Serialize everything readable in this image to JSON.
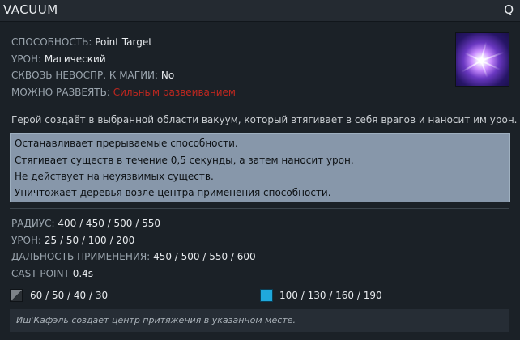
{
  "header": {
    "title": "VACUUM",
    "hotkey": "Q"
  },
  "ability_icon": {
    "name": "vacuum-ability-icon",
    "accent": "#c98cff"
  },
  "properties": [
    {
      "label": "СПОСОБНОСТЬ:",
      "value": "Point Target"
    },
    {
      "label": "УРОН:",
      "value": "Магический"
    },
    {
      "label": "СКВОЗЬ НЕВОСПР. К МАГИИ:",
      "value": "No"
    },
    {
      "label": "МОЖНО РАЗВЕЯТЬ:",
      "value": "Сильным развеиванием",
      "color": "#c0271f"
    }
  ],
  "description": "Герой создаёт в выбранной области вакуум, который втягивает в себя врагов и наносит им урон.",
  "notes": [
    "Останавливает прерываемые способности.",
    "Стягивает существ в течение 0,5 секунды, а затем наносит урон.",
    "Не действует на неуязвимых существ.",
    "Уничтожает деревья возле центра применения способности."
  ],
  "stats": [
    {
      "label": "РАДИУС:",
      "value": "400 / 450 / 500 / 550"
    },
    {
      "label": "УРОН:",
      "value": "25 / 50 / 100 / 200"
    },
    {
      "label": "ДАЛЬНОСТЬ ПРИМЕНЕНИЯ:",
      "value": "450 / 500 / 550 / 600"
    },
    {
      "label": "CAST POINT",
      "value": "0.4s"
    }
  ],
  "cooldown": {
    "icon": "cooldown-icon",
    "value": "60 / 50 / 40 / 30"
  },
  "mana": {
    "icon": "mana-icon",
    "color": "#1fa8dc",
    "value": "100 / 130 / 160 / 190"
  },
  "lore": "Иш'Кафэль создаёт центр притяжения в указанном месте."
}
